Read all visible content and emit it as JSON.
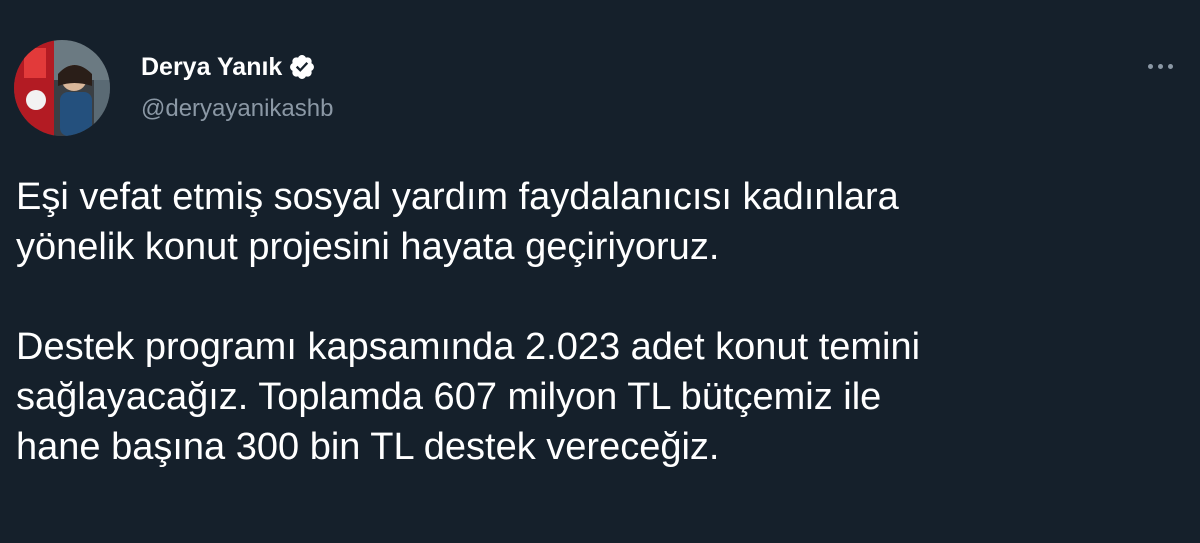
{
  "author": {
    "display_name": "Derya Yanık",
    "handle": "@deryayanikashb",
    "verified": true,
    "avatar_icon": "profile-photo"
  },
  "menu": {
    "icon": "more-horizontal-icon"
  },
  "tweet": {
    "paragraphs": [
      [
        "Eşi vefat etmiş sosyal yardım faydalanıcısı kadınlara",
        "yönelik konut projesini hayata geçiriyoruz."
      ],
      [
        "Destek programı kapsamında 2.023 adet konut temini",
        "sağlayacağız. Toplamda 607 milyon TL bütçemiz ile",
        "hane başına 300 bin TL destek vereceğiz."
      ]
    ]
  },
  "colors": {
    "background": "#15202b",
    "text": "#ffffff",
    "secondary": "#8b98a5",
    "verified_badge": "#ffffff"
  }
}
